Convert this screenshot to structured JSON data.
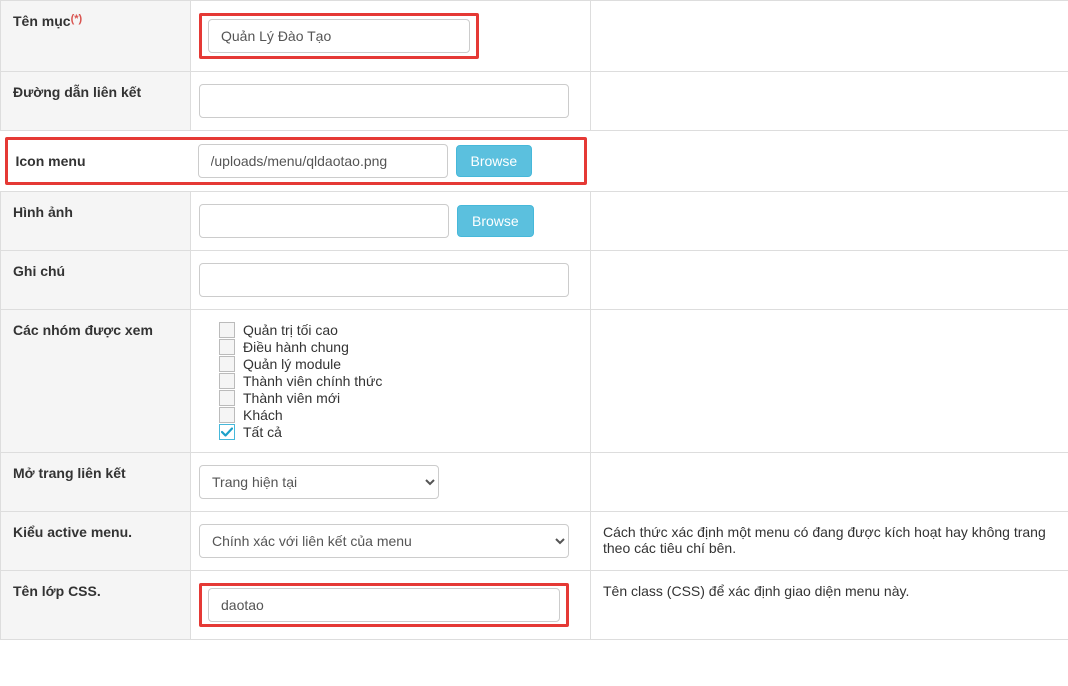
{
  "labels": {
    "itemName": "Tên mục",
    "requiredMark": "(*)",
    "linkPath": "Đường dẫn liên kết",
    "iconMenu": "Icon menu",
    "image": "Hình ảnh",
    "note": "Ghi chú",
    "groupsAllowed": "Các nhóm được xem",
    "openLinkIn": "Mở trang liên kết",
    "activeMenuType": "Kiểu active menu.",
    "cssClassName": "Tên lớp CSS."
  },
  "values": {
    "itemName": "Quản Lý Đào Tạo",
    "linkPath": "",
    "iconMenu": "/uploads/menu/qldaotao.png",
    "image": "",
    "note": "",
    "cssClassName": "daotao"
  },
  "buttons": {
    "browse": "Browse"
  },
  "groups": {
    "items": [
      {
        "label": "Quản trị tối cao",
        "checked": false
      },
      {
        "label": "Điều hành chung",
        "checked": false
      },
      {
        "label": "Quản lý module",
        "checked": false
      },
      {
        "label": "Thành viên chính thức",
        "checked": false
      },
      {
        "label": "Thành viên mới",
        "checked": false
      },
      {
        "label": "Khách",
        "checked": false
      },
      {
        "label": "Tất cả",
        "checked": true
      }
    ]
  },
  "selects": {
    "openLinkOption": "Trang hiện tại",
    "activeMenuOption": "Chính xác với liên kết của menu"
  },
  "help": {
    "activeMenu": "Cách thức xác định một menu có đang được kích hoạt hay không trang theo các tiêu chí bên.",
    "cssClass": "Tên class (CSS) để xác định giao diện menu này."
  }
}
